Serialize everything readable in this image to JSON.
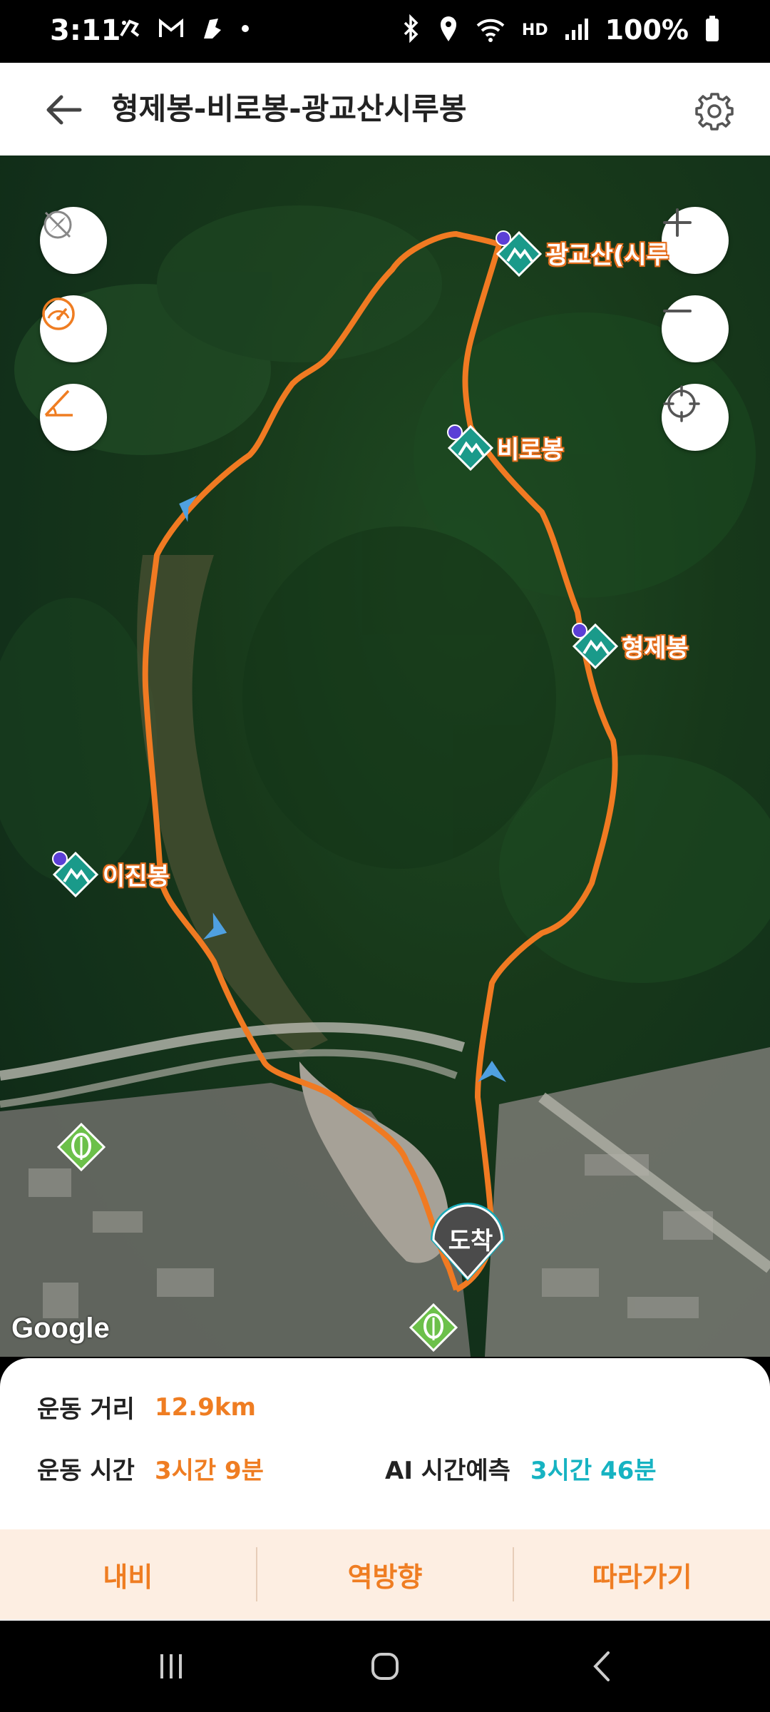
{
  "status_bar": {
    "time": "3:11",
    "battery": "100%",
    "network_label": "HD"
  },
  "header": {
    "title": "형제봉-비로봉-광교산시루봉"
  },
  "map": {
    "peaks": [
      {
        "name": "광교산(시루"
      },
      {
        "name": "비로봉"
      },
      {
        "name": "형제봉"
      },
      {
        "name": "이진봉"
      }
    ],
    "arrival_label": "도착",
    "provider": "Google",
    "route_color": "#f07a22"
  },
  "info": {
    "distance_label": "운동 거리",
    "distance_value": "12.9km",
    "time_label": "운동 시간",
    "time_value": "3시간 9분",
    "ai_label": "AI 시간예측",
    "ai_value": "3시간 46분"
  },
  "actions": {
    "navigate": "내비",
    "reverse": "역방향",
    "follow": "따라가기"
  },
  "colors": {
    "accent": "#ef7d22",
    "teal": "#16b3c2",
    "action_bg": "#fdeee2"
  }
}
